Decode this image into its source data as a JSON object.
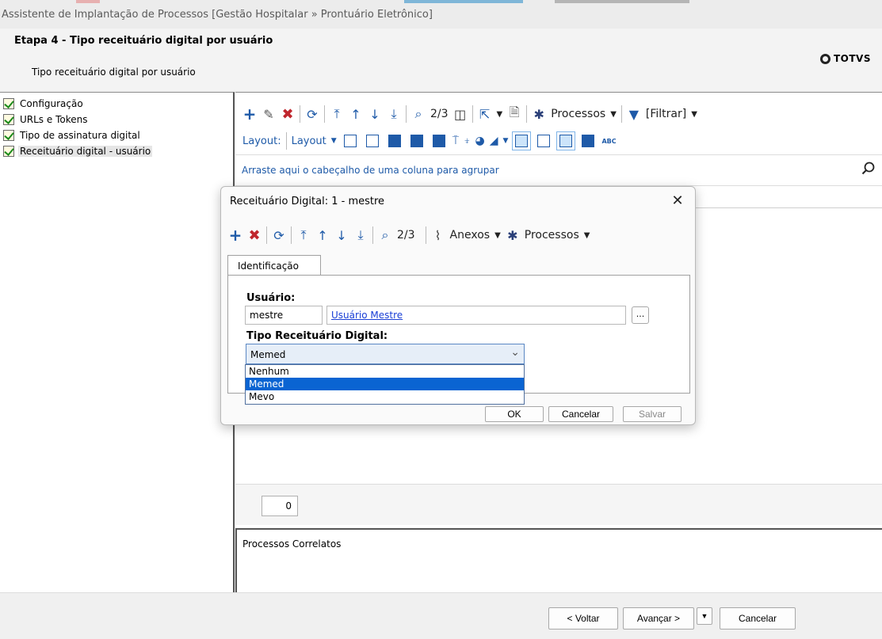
{
  "window": {
    "title": "Assistente de Implantação de Processos [Gestão Hospitalar » Prontuário Eletrônico]"
  },
  "header": {
    "step": "Etapa 4 - Tipo receituário digital por usuário",
    "subtitle": "Tipo receituário digital por usuário",
    "logo": "TOTVS"
  },
  "steps": [
    {
      "label": "Configuração",
      "icon": "checkbox-checked-icon"
    },
    {
      "label": "URLs e Tokens",
      "icon": "checkbox-checked-icon"
    },
    {
      "label": "Tipo de assinatura digital",
      "icon": "checkbox-checked-icon"
    },
    {
      "label": "Receituário digital - usuário",
      "icon": "checkbox-checked-icon",
      "selected": true
    }
  ],
  "main_toolbar": {
    "record_position": "2/3",
    "processos": "Processos",
    "filtrar": "[Filtrar]",
    "layout_label": "Layout:",
    "layout_menu": "Layout"
  },
  "grid": {
    "group_hint": "Arraste aqui o cabeçalho de uma coluna para agrupar",
    "count": "0",
    "related": "Processos Correlatos"
  },
  "dialog": {
    "title": "Receituário Digital: 1 - mestre",
    "record_position": "2/3",
    "anexos": "Anexos",
    "processos": "Processos",
    "tab": "Identificação",
    "usuario_label": "Usuário:",
    "usuario_code": "mestre",
    "usuario_name": "Usuário Mestre",
    "ellipsis": "...",
    "tipo_label": "Tipo Receituário Digital:",
    "tipo_selected": "Memed",
    "tipo_options": [
      "Nenhum",
      "Memed",
      "Mevo"
    ],
    "ok": "OK",
    "cancelar": "Cancelar",
    "salvar": "Salvar"
  },
  "footer": {
    "voltar": "< Voltar",
    "avancar": "Avançar >",
    "cancelar": "Cancelar"
  },
  "colors": {
    "accent": "#1e5aa8",
    "delete": "#c0262d",
    "selection": "#0a64d2",
    "link": "#1a3fd6"
  }
}
